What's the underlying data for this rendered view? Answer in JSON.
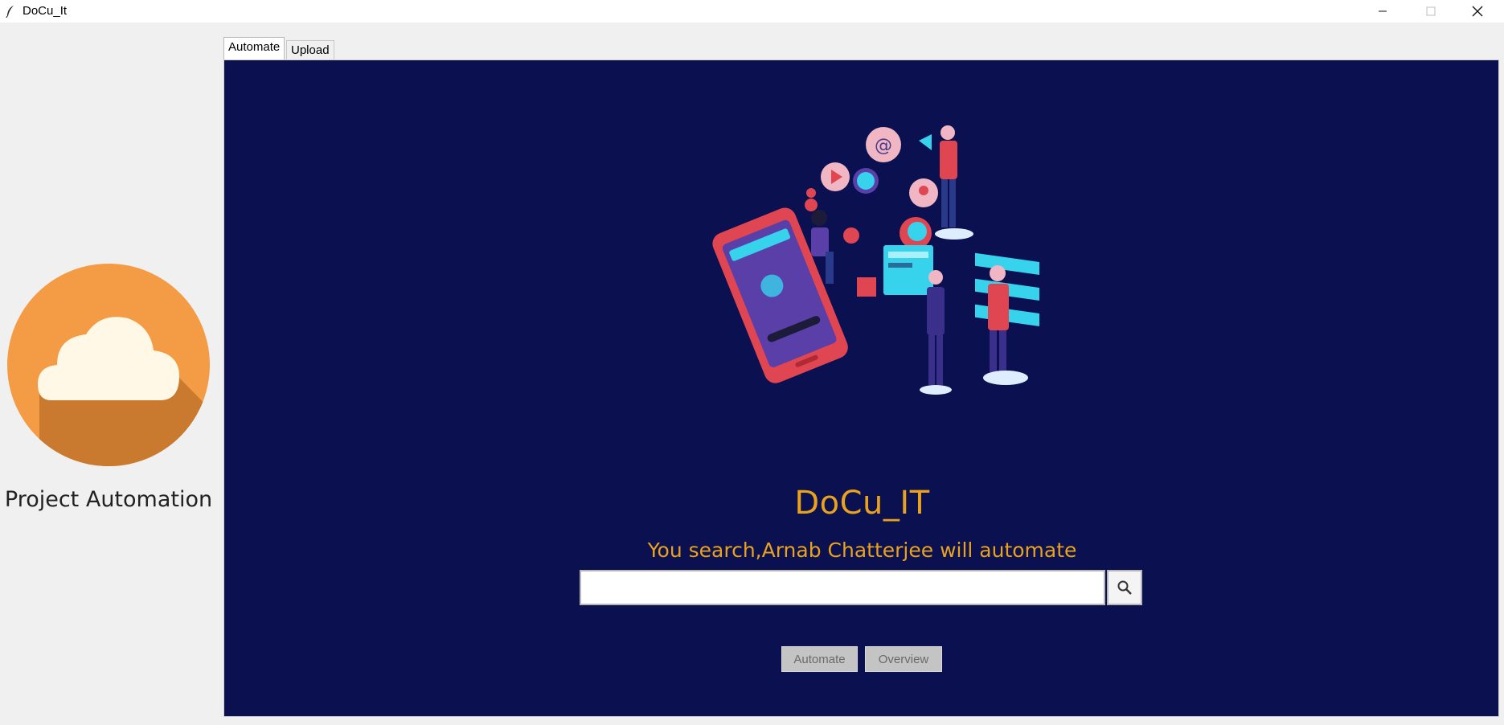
{
  "window": {
    "title": "DoCu_It",
    "icon": "feather-icon",
    "controls": [
      "minimize-icon",
      "maximize-icon",
      "close-icon"
    ]
  },
  "sidebar": {
    "logo_icon": "cloud-icon",
    "label": "Project Automation"
  },
  "tabs": [
    {
      "label": "Automate",
      "active": true
    },
    {
      "label": "Upload",
      "active": false
    }
  ],
  "main": {
    "illustration": "social-media-marketing-illustration",
    "title": "DoCu_IT",
    "subtitle": "You search,Arnab Chatterjee will automate",
    "search": {
      "value": "",
      "placeholder": "",
      "button_icon": "search-icon"
    },
    "buttons": {
      "automate": "Automate",
      "overview": "Overview"
    }
  },
  "colors": {
    "panel_bg": "#0a1050",
    "accent": "#e8a21c",
    "logo_orange": "#f39c45",
    "logo_shadow": "#c97a2e",
    "cloud": "#fff8e6"
  }
}
